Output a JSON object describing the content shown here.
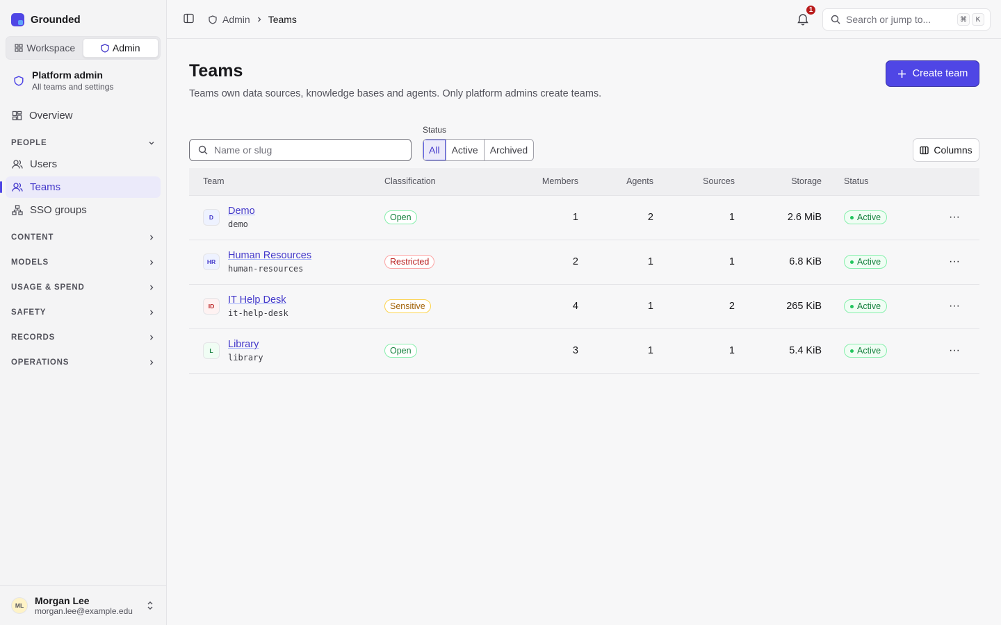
{
  "brand": {
    "name": "Grounded"
  },
  "mode_switch": {
    "workspace": "Workspace",
    "admin": "Admin"
  },
  "context": {
    "title": "Platform admin",
    "subtitle": "All teams and settings"
  },
  "nav": {
    "overview": "Overview",
    "people_section": "PEOPLE",
    "people": [
      "Users",
      "Teams",
      "SSO groups"
    ],
    "sections": [
      "CONTENT",
      "MODELS",
      "USAGE & SPEND",
      "SAFETY",
      "RECORDS",
      "OPERATIONS"
    ]
  },
  "user": {
    "initials": "ML",
    "name": "Morgan Lee",
    "email": "morgan.lee@example.edu"
  },
  "topbar": {
    "breadcrumb": [
      "Admin",
      "Teams"
    ],
    "notifications_count": "1",
    "search_placeholder": "Search or jump to...",
    "shortcut": [
      "⌘",
      "K"
    ]
  },
  "page": {
    "title": "Teams",
    "subtitle": "Teams own data sources, knowledge bases and agents. Only platform admins create teams.",
    "create_button": "Create team"
  },
  "filters": {
    "search_placeholder": "Name or slug",
    "status_label": "Status",
    "status_options": [
      "All",
      "Active",
      "Archived"
    ],
    "status_selected": "All",
    "columns_button": "Columns"
  },
  "table": {
    "headers": [
      "Team",
      "Classification",
      "Members",
      "Agents",
      "Sources",
      "Storage",
      "Status"
    ],
    "rows": [
      {
        "initials": "D",
        "name": "Demo",
        "slug": "demo",
        "classification": "Open",
        "members": "1",
        "agents": "2",
        "sources": "1",
        "storage": "2.6 MiB",
        "status": "Active"
      },
      {
        "initials": "HR",
        "name": "Human Resources",
        "slug": "human-resources",
        "classification": "Restricted",
        "members": "2",
        "agents": "1",
        "sources": "1",
        "storage": "6.8 KiB",
        "status": "Active"
      },
      {
        "initials": "ID",
        "name": "IT Help Desk",
        "slug": "it-help-desk",
        "classification": "Sensitive",
        "members": "4",
        "agents": "1",
        "sources": "2",
        "storage": "265 KiB",
        "status": "Active"
      },
      {
        "initials": "L",
        "name": "Library",
        "slug": "library",
        "classification": "Open",
        "members": "3",
        "agents": "1",
        "sources": "1",
        "storage": "5.4 KiB",
        "status": "Active"
      }
    ]
  },
  "colors": {
    "accent": "#4f46e5",
    "open": "#15803d",
    "restricted": "#b91c1c",
    "sensitive": "#a16207"
  }
}
